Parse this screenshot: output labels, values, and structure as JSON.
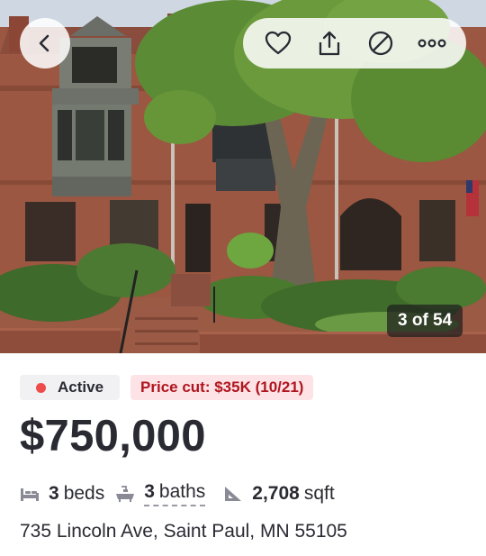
{
  "listing": {
    "photo_counter": "3 of 54",
    "status_label": "Active",
    "price_cut_label": "Price cut: $35K (10/21)",
    "price": "$750,000",
    "beds_num": "3",
    "beds_unit": "beds",
    "baths_num": "3",
    "baths_unit": "baths",
    "sqft_num": "2,708",
    "sqft_unit": "sqft",
    "address": "735 Lincoln Ave, Saint Paul, MN 55105"
  },
  "icons": {
    "back": "chevron-left-icon",
    "save": "heart-icon",
    "share": "share-icon",
    "hide": "hide-icon",
    "more": "more-icon",
    "beds": "bed-icon",
    "baths": "bathtub-icon",
    "sqft": "ruler-triangle-icon"
  },
  "colors": {
    "status_dot": "#ee4b4b",
    "price_cut_bg": "#fde3e6",
    "price_cut_text": "#b0151f",
    "text_primary": "#2a2a33"
  }
}
